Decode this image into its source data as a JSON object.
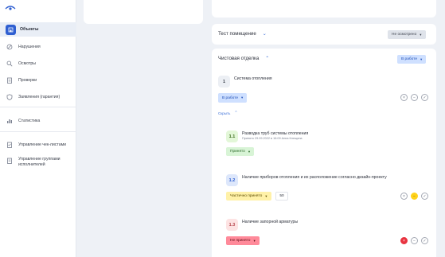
{
  "sidebar": {
    "items": [
      {
        "label": "Объекты",
        "icon": "building-icon"
      },
      {
        "label": "Нарушения",
        "icon": "ban-icon"
      },
      {
        "label": "Осмотры",
        "icon": "search-icon"
      },
      {
        "label": "Проверки",
        "icon": "clipboard-icon"
      },
      {
        "label": "Заявления (гарантия)",
        "icon": "shield-icon"
      },
      {
        "label": "Статистика",
        "icon": "chart-icon"
      },
      {
        "label": "Управление чек-листами",
        "icon": "checklist-icon"
      },
      {
        "label": "Управление группами исполнителей",
        "icon": "group-icon"
      }
    ]
  },
  "sections": {
    "test_room": {
      "title": "Тест помещение",
      "status": "Не осмотрено"
    },
    "finish": {
      "title": "Чистовая отделка",
      "status": "В работе"
    }
  },
  "system": {
    "number": "1",
    "title": "Система отопления",
    "status": "В работе",
    "hide_link": "Скрыть"
  },
  "items": [
    {
      "number": "1.1",
      "title": "Разводка труб системы отопления",
      "meta": "Принято 29.09.2022 в 16:09 Анна Клещина",
      "status": "Принято"
    },
    {
      "number": "1.2",
      "title": "Наличие приборов отопления и их расположение согласно дизайн-проекту",
      "status": "Частично принято",
      "value": "50"
    },
    {
      "number": "1.3",
      "title": "Наличие запорной арматуры",
      "status": "Не принято"
    }
  ],
  "colors": {
    "accent": "#2f5fd1",
    "accepted": "#d8f4d6",
    "partial": "#fff1a8",
    "rejected": "#ff8a9a"
  }
}
